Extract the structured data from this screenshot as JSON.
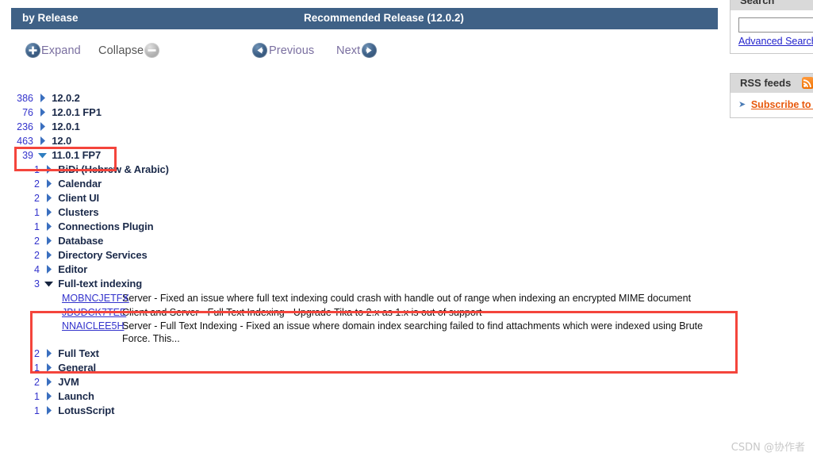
{
  "header": {
    "left_title": "by Release",
    "right_title": "Recommended Release (12.0.2)"
  },
  "toolbar": {
    "expand_label": "Expand",
    "collapse_label": "Collapse",
    "previous_label": "Previous",
    "next_label": "Next",
    "expand_icon": "plus-circle-icon",
    "collapse_icon": "minus-circle-icon",
    "previous_icon": "arrow-left-circle-icon",
    "next_icon": "arrow-right-circle-icon"
  },
  "tree": {
    "releases": [
      {
        "count": "386",
        "label": "12.0.2",
        "expanded": false
      },
      {
        "count": "76",
        "label": "12.0.1 FP1",
        "expanded": false
      },
      {
        "count": "236",
        "label": "12.0.1",
        "expanded": false
      },
      {
        "count": "463",
        "label": "12.0",
        "expanded": false
      },
      {
        "count": "39",
        "label": "11.0.1 FP7",
        "expanded": true
      }
    ],
    "categories_before": [
      {
        "count": "1",
        "label": "BiDi (Hebrew & Arabic)",
        "expanded": false
      },
      {
        "count": "2",
        "label": "Calendar",
        "expanded": false
      },
      {
        "count": "2",
        "label": "Client UI",
        "expanded": false
      },
      {
        "count": "1",
        "label": "Clusters",
        "expanded": false
      },
      {
        "count": "1",
        "label": "Connections Plugin",
        "expanded": false
      },
      {
        "count": "2",
        "label": "Database",
        "expanded": false
      },
      {
        "count": "2",
        "label": "Directory Services",
        "expanded": false
      },
      {
        "count": "4",
        "label": "Editor",
        "expanded": false
      }
    ],
    "expanded_category": {
      "count": "3",
      "label": "Full-text indexing",
      "expanded": true,
      "items": [
        {
          "id": "MOBNCJETFX",
          "text": "Server - Fixed an issue where full text indexing could crash with handle out of range when indexing an encrypted MIME document"
        },
        {
          "id": "JBUDCK7TEE",
          "text": "Client and Server - Full Text Indexing - Upgrade Tika to 2.x as 1.x is out of support"
        },
        {
          "id": "NNAICLEE5H",
          "text": "Server - Full Text Indexing - Fixed an issue where domain index searching failed to find attachments which were indexed using Brute Force. This..."
        }
      ]
    },
    "categories_after": [
      {
        "count": "2",
        "label": "Full Text",
        "expanded": false
      },
      {
        "count": "1",
        "label": "General",
        "expanded": false
      },
      {
        "count": "2",
        "label": "JVM",
        "expanded": false
      },
      {
        "count": "1",
        "label": "Launch",
        "expanded": false
      },
      {
        "count": "1",
        "label": "LotusScript",
        "expanded": false
      }
    ]
  },
  "sidebar": {
    "search_panel": {
      "title": "Search",
      "input_value": "",
      "input_placeholder": "",
      "advanced_link": "Advanced Search"
    },
    "rss_panel": {
      "title": "RSS feeds",
      "badge_icon": "rss-icon",
      "subscribe_link": "Subscribe to list"
    }
  },
  "colors": {
    "header_bar": "#3f6186",
    "annotation_red": "#f4453c",
    "link_blue": "#3333cc",
    "rss_orange": "#e8590c"
  },
  "watermark": "CSDN @协作者"
}
